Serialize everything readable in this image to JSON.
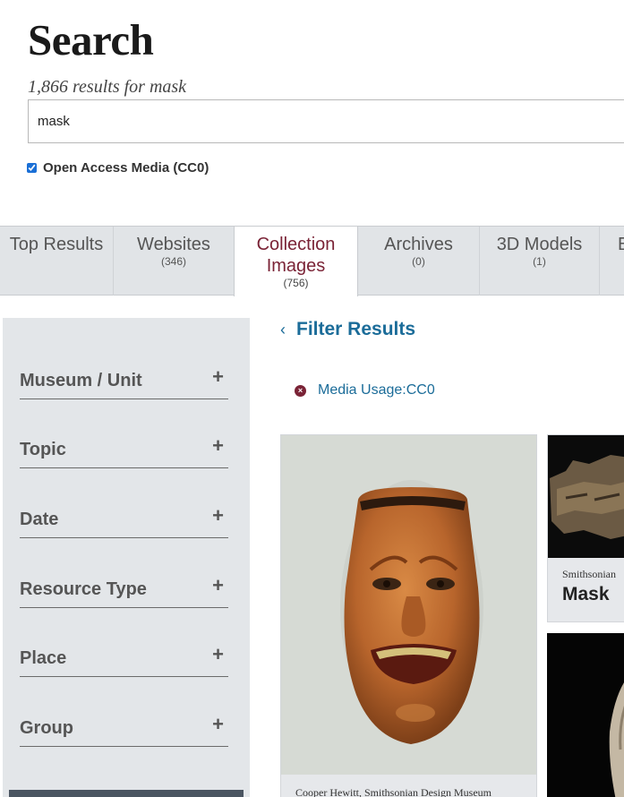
{
  "header": {
    "title": "Search",
    "result_count": "1,866 results for mask"
  },
  "search": {
    "value": "mask"
  },
  "filters": {
    "cc0_label": "Open Access Media (CC0)"
  },
  "tabs": [
    {
      "label": "Top Results",
      "count": ""
    },
    {
      "label": "Websites",
      "count": "(346)"
    },
    {
      "label": "Collection Images",
      "count": "(756)"
    },
    {
      "label": "Archives",
      "count": "(0)"
    },
    {
      "label": "3D Models",
      "count": "(1)"
    },
    {
      "label": "E",
      "count": ""
    }
  ],
  "sidebar": {
    "facets": [
      {
        "label": "Museum / Unit"
      },
      {
        "label": "Topic"
      },
      {
        "label": "Date"
      },
      {
        "label": "Resource Type"
      },
      {
        "label": "Place"
      },
      {
        "label": "Group"
      }
    ],
    "plus_symbol": "+"
  },
  "filter_panel": {
    "title": "Filter Results",
    "chevron": "‹",
    "active_filter": "Media Usage:CC0",
    "remove_symbol": "×"
  },
  "results": [
    {
      "source": "Cooper Hewitt, Smithsonian Design Museum",
      "title": ""
    },
    {
      "source": "Smithsonian",
      "title": "Mask"
    }
  ]
}
